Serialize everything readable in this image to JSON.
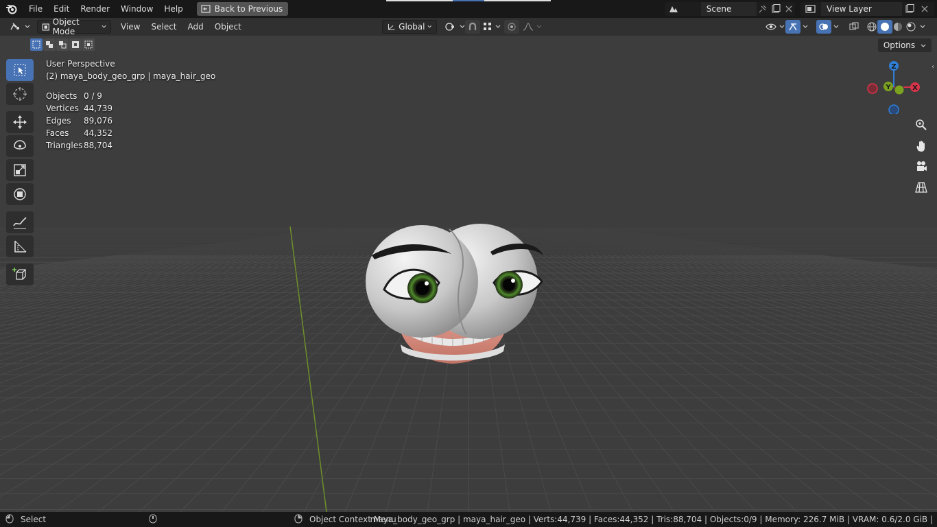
{
  "topbar": {
    "menus": [
      "File",
      "Edit",
      "Render",
      "Window",
      "Help"
    ],
    "back_button": "Back to Previous",
    "scene": "Scene",
    "view_layer": "View Layer"
  },
  "header": {
    "mode": "Object Mode",
    "menus": [
      "View",
      "Select",
      "Add",
      "Object"
    ],
    "orientation": "Global",
    "options": "Options"
  },
  "overlay": {
    "perspective": "User Perspective",
    "active_object": "(2) maya_body_geo_grp | maya_hair_geo",
    "stats": [
      {
        "key": "Objects",
        "value": "0 / 9"
      },
      {
        "key": "Vertices",
        "value": "44,739"
      },
      {
        "key": "Edges",
        "value": "89,076"
      },
      {
        "key": "Faces",
        "value": "44,352"
      },
      {
        "key": "Triangles",
        "value": "88,704"
      }
    ]
  },
  "gizmo": {
    "z": "Z",
    "y": "Y",
    "x": "X"
  },
  "statusbar": {
    "select": "Select",
    "context_menu": "Object Context Menu",
    "info": "maya_body_geo_grp | maya_hair_geo | Verts:44,739 | Faces:44,352 | Tris:88,704 | Objects:0/9 | Memory: 226.7 MiB | VRAM: 0.6/2.0 GiB |"
  },
  "colors": {
    "accent": "#4772b3",
    "axis_x": "#d9344a",
    "axis_y": "#7ca320",
    "axis_z": "#2f7ed8"
  }
}
